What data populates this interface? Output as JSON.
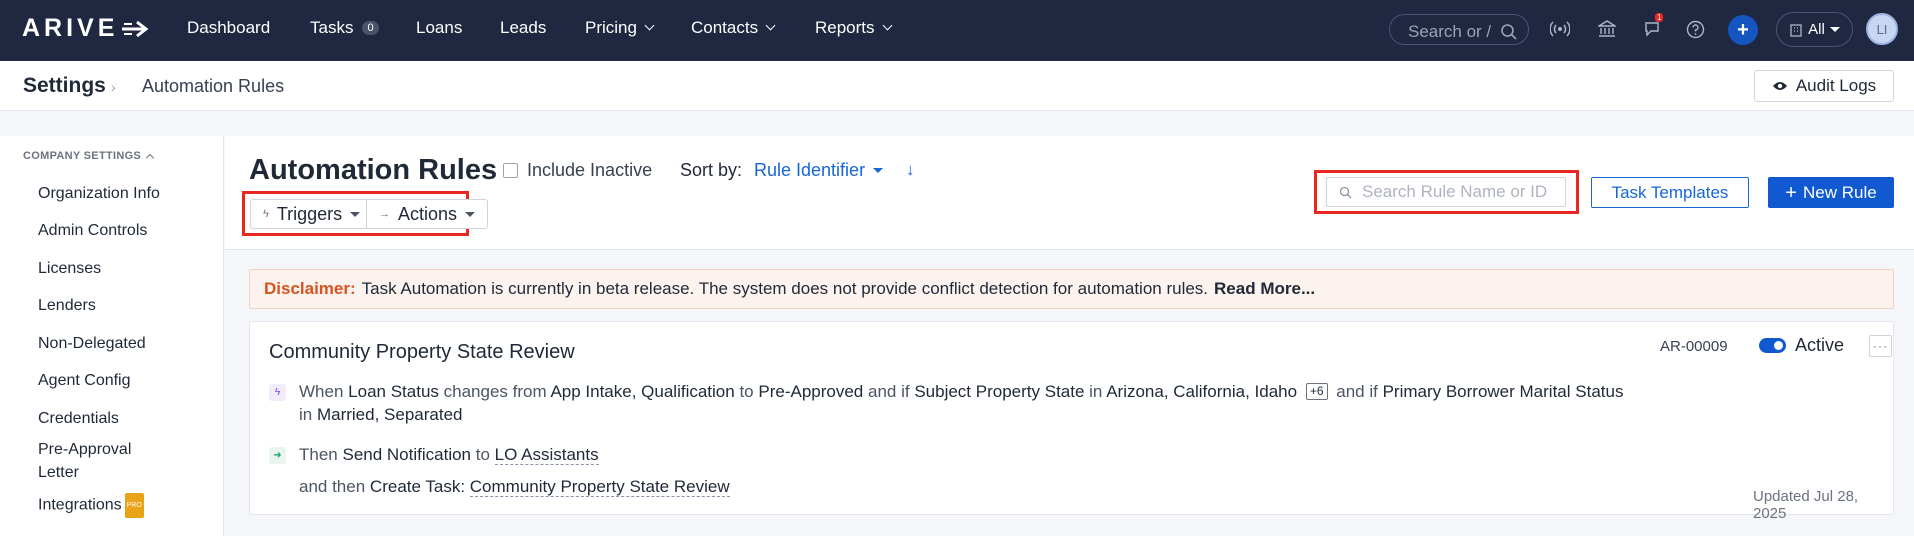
{
  "nav": {
    "logo": "ARIVE",
    "items": [
      {
        "label": "Dashboard"
      },
      {
        "label": "Tasks",
        "badge": "0"
      },
      {
        "label": "Loans"
      },
      {
        "label": "Leads"
      },
      {
        "label": "Pricing"
      },
      {
        "label": "Contacts"
      },
      {
        "label": "Reports"
      }
    ],
    "search_placeholder": "Search or /",
    "notification_count": "1",
    "filter_label": "All",
    "avatar_initials": "LI"
  },
  "breadcrumb": {
    "root": "Settings",
    "current": "Automation Rules"
  },
  "audit_button": "Audit Logs",
  "sidebar": {
    "section": "COMPANY SETTINGS",
    "items": [
      "Organization Info",
      "Admin Controls",
      "Licenses",
      "Lenders",
      "Non-Delegated",
      "Agent Config",
      "Credentials",
      "Pre-Approval Letter",
      "Integrations"
    ],
    "pro_badge": "PRO"
  },
  "header": {
    "title": "Automation Rules",
    "include_inactive": "Include Inactive",
    "sort_label": "Sort by:",
    "sort_value": "Rule Identifier",
    "sort_direction": "↓",
    "triggers": "Triggers",
    "actions": "Actions",
    "search_placeholder": "Search Rule Name or ID",
    "task_templates": "Task Templates",
    "new_rule": "New Rule"
  },
  "disclaimer": {
    "label": "Disclaimer:",
    "text": "Task Automation is currently in beta release. The system does not provide conflict detection for automation rules.",
    "link": "Read More..."
  },
  "rule": {
    "name": "Community Property State Review",
    "id": "AR-00009",
    "status": "Active",
    "when": "When",
    "field1": "Loan Status",
    "changes_from": "changes from",
    "from_values": "App Intake, Qualification",
    "to": "to",
    "to_value": "Pre-Approved",
    "and_if": "and if",
    "field2": "Subject Property State",
    "in": "in",
    "states": "Arizona, California, Idaho",
    "more_count": "+6",
    "and_if2": "and if",
    "field3": "Primary Borrower Marital Status",
    "in2": "in",
    "marital_values": "Married, Separated",
    "then": "Then",
    "action1": "Send Notification",
    "to2": "to",
    "recipient": "LO Assistants",
    "and_then": "and then",
    "action2": "Create Task:",
    "task_name": "Community Property State Review",
    "updated": "Updated Jul 28, 2025"
  }
}
